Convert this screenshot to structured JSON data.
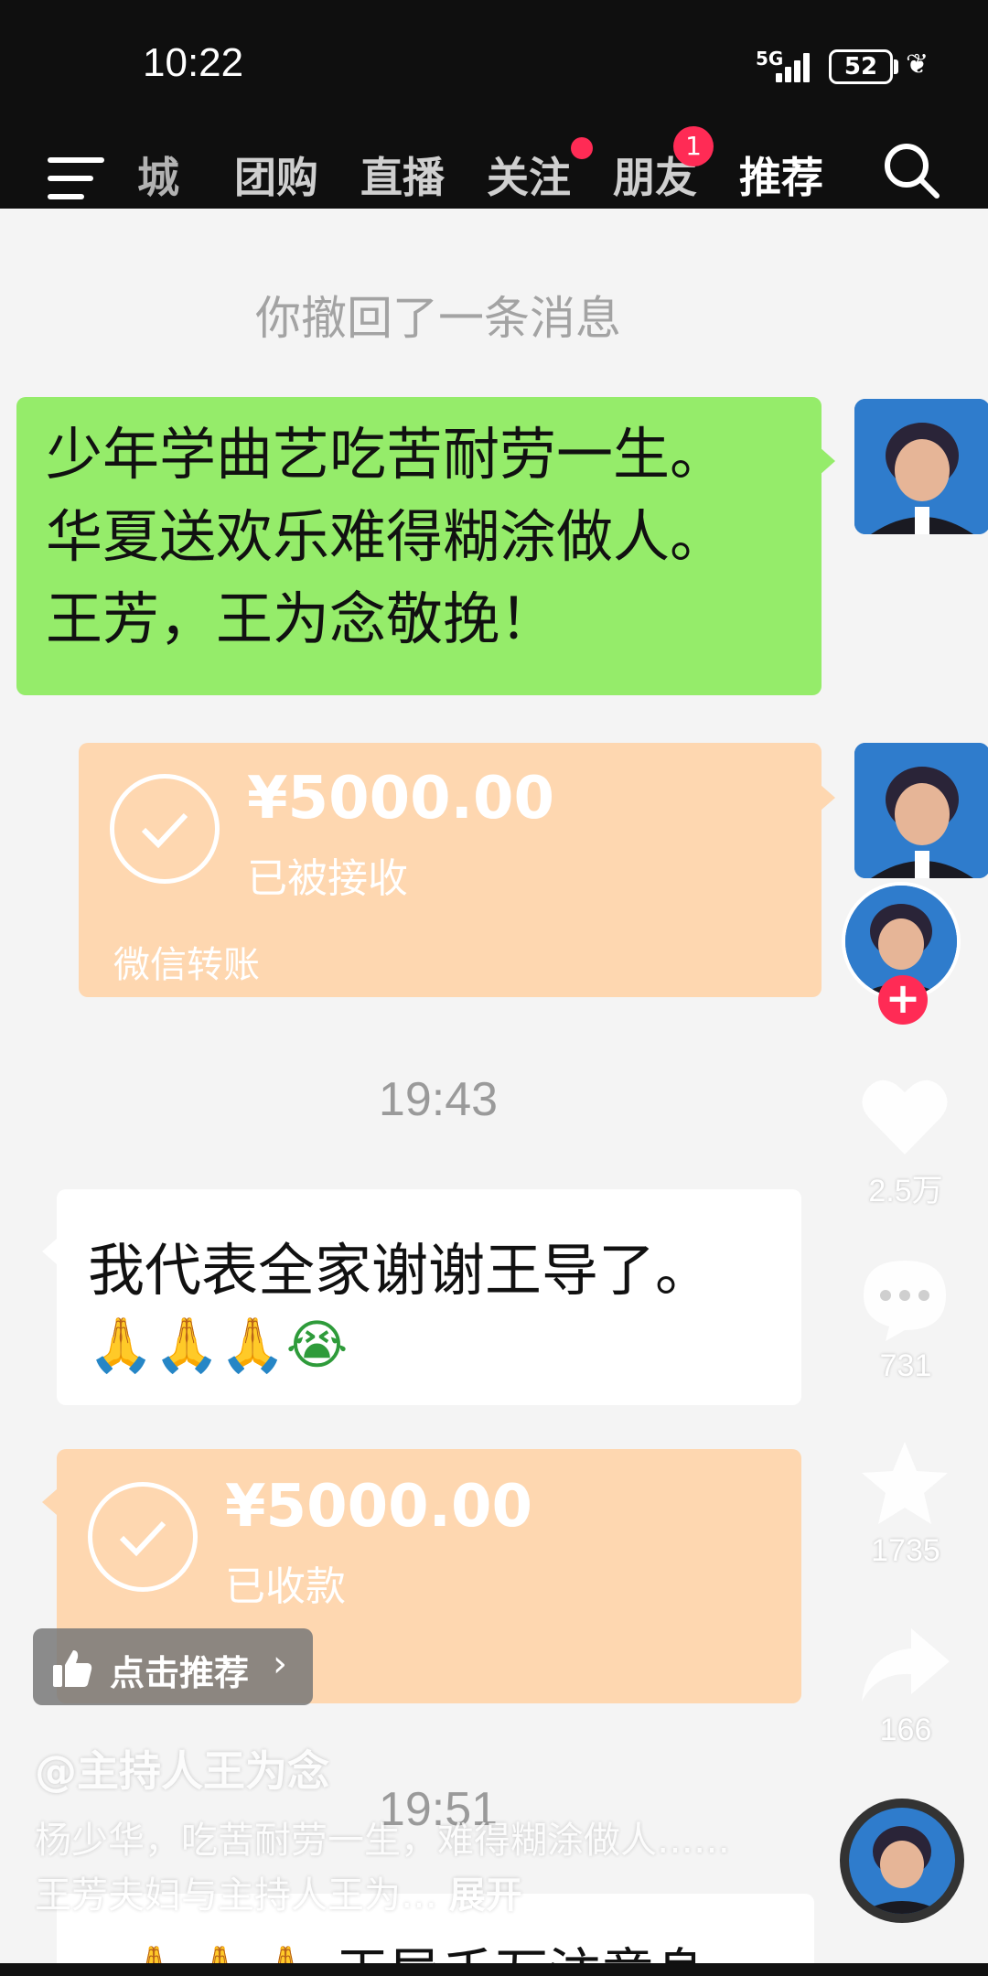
{
  "status_bar": {
    "time": "10:22",
    "network": "5G",
    "battery": "52"
  },
  "top_nav": {
    "tabs": [
      {
        "label": "城",
        "active": false
      },
      {
        "label": "团购",
        "active": false
      },
      {
        "label": "直播",
        "active": false
      },
      {
        "label": "关注",
        "active": false,
        "dot": true
      },
      {
        "label": "朋友",
        "active": false,
        "badge": "1"
      },
      {
        "label": "推荐",
        "active": true
      }
    ]
  },
  "chat": {
    "recall_notice": "你撤回了一条消息",
    "green_message": {
      "lines": [
        "少年学曲艺吃苦耐劳一生。",
        "华夏送欢乐难得糊涂做人。",
        "王芳，王为念敬挽！"
      ]
    },
    "transfer_1": {
      "amount": "¥5000.00",
      "status": "已被接收",
      "brand": "微信转账"
    },
    "timestamp_1": "19:43",
    "white_message": {
      "text": "我代表全家谢谢王导了。",
      "emojis": "🙏🙏🙏😭"
    },
    "transfer_2": {
      "amount": "¥5000.00",
      "status": "已收款"
    },
    "timestamp_2": "19:51",
    "bottom_message": "🙏🙏🙏 王导千万注意身"
  },
  "overlay": {
    "recommend_label": "点击推荐",
    "author": "@主持人王为念",
    "description": "杨少华，吃苦耐劳一生，难得糊涂做人……王芳夫妇与主持人王为…",
    "expand": "展开"
  },
  "actions": {
    "likes": "2.5万",
    "comments": "731",
    "favorites": "1735",
    "shares": "166"
  },
  "colors": {
    "green_bubble": "#95ec6a",
    "transfer": "#fed7b0",
    "accent": "#ff2b55"
  }
}
